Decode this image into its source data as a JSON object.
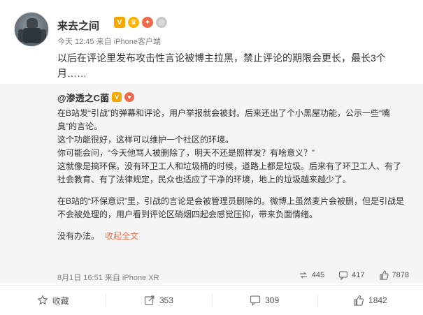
{
  "post": {
    "author": "来去之间",
    "meta": "今天 12:45 来自 iPhone客户端",
    "text": "以后在评论里发布攻击性言论被博主拉黑，禁止评论的期限会更长，最长3个月……"
  },
  "repost": {
    "author": "@渗透之C菌",
    "lines": [
      "在B站发“引战”的弹幕和评论，用户举报就会被封。后来还出了个小黑屋功能，公示一些“嘴",
      "臭”的言论。",
      "这个功能很好，这样可以维护一个社区的环境。",
      "你可能会问，“今天他骂人被删除了，明天不还是照样发？有啥意义？”",
      "这就像是搞环保。没有环卫工人和垃圾桶的时候，道路上都是垃圾。后来有了环卫工人、有了",
      "社会教育、有了法律规定，民众也适应了干净的环境，地上的垃圾越来越少了。"
    ],
    "lines2": [
      "在B站的“环保意识”里，引战的言论是会被管理员删除的。微博上虽然麦片会被删，但是引战是",
      "不会被处理的，用户看到评论区硝烟四起会感觉压抑，带来负面情绪。"
    ],
    "last_line": "没有办法。",
    "expand_label": "收起全文",
    "footer_time": "8月1日 16:51 来自 iPhone XR",
    "stats": {
      "reposts": "445",
      "comments": "417",
      "likes": "7878"
    }
  },
  "actions": {
    "favorite": "收藏",
    "repost": "353",
    "comment": "309",
    "like": "1842"
  },
  "colors": {
    "accent": "#eb7350",
    "repost_bg": "#f5f5f5",
    "text": "#333333",
    "muted": "#808080"
  }
}
